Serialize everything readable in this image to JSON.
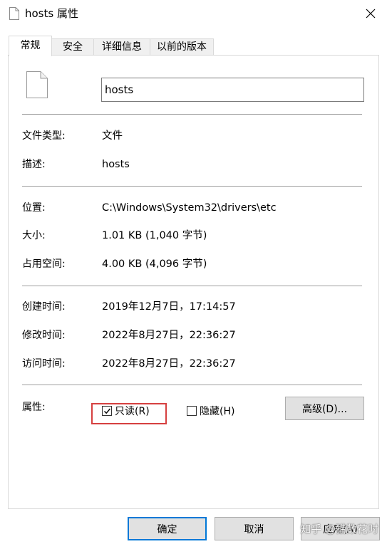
{
  "window": {
    "title": "hosts 属性",
    "close_label": "×"
  },
  "tabs": [
    {
      "label": "常规",
      "active": true
    },
    {
      "label": "安全",
      "active": false
    },
    {
      "label": "详细信息",
      "active": false
    },
    {
      "label": "以前的版本",
      "active": false
    }
  ],
  "general": {
    "file_name": "hosts",
    "file_type_label": "文件类型:",
    "file_type_value": "文件",
    "description_label": "描述:",
    "description_value": "hosts",
    "location_label": "位置:",
    "location_value": "C:\\Windows\\System32\\drivers\\etc",
    "size_label": "大小:",
    "size_value": "1.01 KB (1,040 字节)",
    "size_on_disk_label": "占用空间:",
    "size_on_disk_value": "4.00 KB (4,096 字节)",
    "created_label": "创建时间:",
    "created_value": "2019年12月7日，17:14:57",
    "modified_label": "修改时间:",
    "modified_value": "2022年8月27日，22:36:27",
    "accessed_label": "访问时间:",
    "accessed_value": "2022年8月27日，22:36:27"
  },
  "attributes": {
    "label": "属性:",
    "readonly_label": "只读(R)",
    "readonly_checked": true,
    "hidden_label": "隐藏(H)",
    "hidden_checked": false,
    "advanced_label": "高级(D)..."
  },
  "buttons": {
    "ok": "确定",
    "cancel": "取消",
    "apply": "应用(A)"
  },
  "watermark": "知乎 @猎数花时",
  "colors": {
    "highlight_box": "#d64040",
    "primary_border": "#0078d7"
  }
}
